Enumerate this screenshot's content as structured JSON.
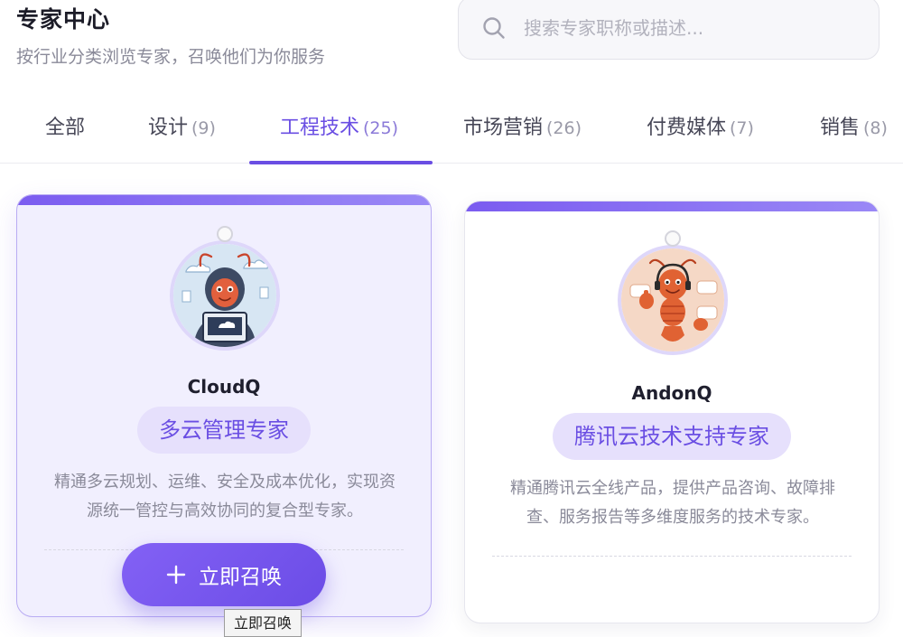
{
  "header": {
    "title": "专家中心",
    "subtitle": "按行业分类浏览专家，召唤他们为你服务"
  },
  "search": {
    "placeholder": "搜索专家职称或描述...",
    "value": ""
  },
  "tabs": [
    {
      "label": "全部",
      "count": ""
    },
    {
      "label": "设计",
      "count": "(9)"
    },
    {
      "label": "工程技术",
      "count": "(25)",
      "active": true
    },
    {
      "label": "市场营销",
      "count": "(26)"
    },
    {
      "label": "付费媒体",
      "count": "(7)"
    },
    {
      "label": "销售",
      "count": "(8)"
    }
  ],
  "experts": [
    {
      "name": "CloudQ",
      "role": "多云管理专家",
      "description": "精通多云规划、运维、安全及成本优化，实现资源统一管控与高效协同的复合型专家。",
      "highlighted": true
    },
    {
      "name": "AndonQ",
      "role": "腾讯云技术支持专家",
      "description": "精通腾讯云全线产品，提供产品咨询、故障排查、服务报告等多维度服务的技术专家。",
      "highlighted": false
    }
  ],
  "summon_button": {
    "label": "立即召唤",
    "icon": "plus-icon"
  },
  "tooltip": {
    "text": "立即召唤"
  },
  "colors": {
    "accent": "#6a4ee3",
    "badge_bg": "#e6e0fc",
    "card_highlight_bg": "#f1effe"
  }
}
